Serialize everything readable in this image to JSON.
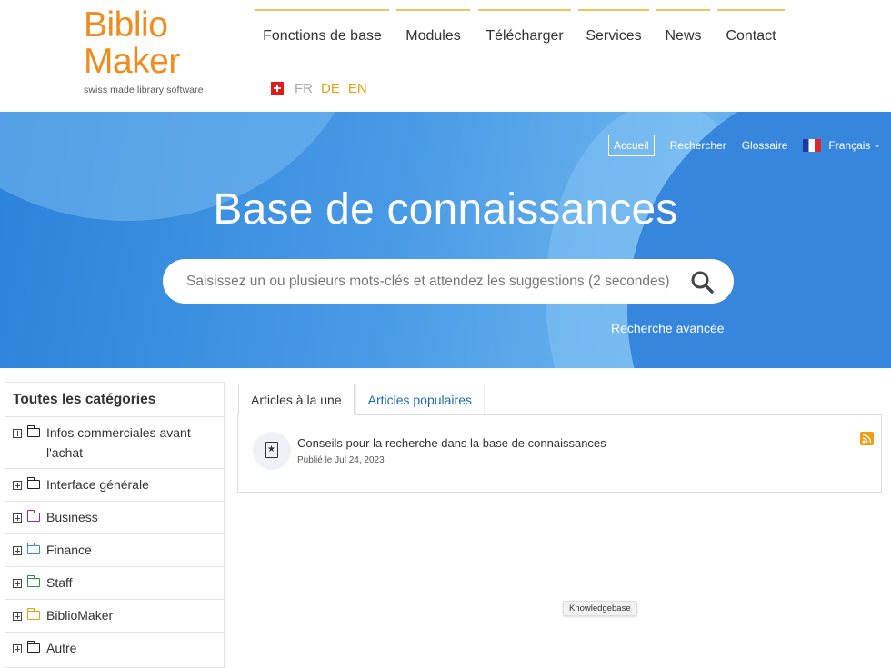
{
  "logo": {
    "line1": "Biblio",
    "line2": "Maker",
    "tagline": "swiss made library software"
  },
  "main_nav": [
    {
      "label": "Fonctions de base"
    },
    {
      "label": "Modules"
    },
    {
      "label": "Télécharger"
    },
    {
      "label": "Services"
    },
    {
      "label": "News"
    },
    {
      "label": "Contact"
    }
  ],
  "languages": {
    "fr": "FR",
    "de": "DE",
    "en": "EN",
    "current": "FR"
  },
  "hero": {
    "nav": {
      "home": "Accueil",
      "search": "Rechercher",
      "glossary": "Glossaire",
      "language": "Français"
    },
    "title": "Base de connaissances",
    "search_placeholder": "Saisissez un ou plusieurs mots-clés et attendez les suggestions (2 secondes)",
    "advanced_search": "Recherche avancée"
  },
  "categories": {
    "heading": "Toutes les catégories",
    "items": [
      {
        "label": "Infos commerciales avant l'achat",
        "folder_color": "#222222"
      },
      {
        "label": "Interface générale",
        "folder_color": "#222222"
      },
      {
        "label": "Business",
        "folder_color": "#9b27af"
      },
      {
        "label": "Finance",
        "folder_color": "#2d8ee6"
      },
      {
        "label": "Staff",
        "folder_color": "#1e9c3f"
      },
      {
        "label": "BiblioMaker",
        "folder_color": "#e7a20f"
      },
      {
        "label": "Autre",
        "folder_color": "#222222"
      }
    ]
  },
  "tabs": {
    "featured": "Articles à la une",
    "popular": "Articles populaires",
    "active": "featured"
  },
  "articles": [
    {
      "title": "Conseils pour la recherche dans la base de connaissances",
      "date": "Publié le Jul 24, 2023"
    }
  ],
  "tooltip": "Knowledgebase",
  "colors": {
    "brand_orange": "#f08c1b",
    "nav_accent": "#f5c15a",
    "hero_blue": "#2b82d9",
    "link_blue": "#1a6bb5",
    "rss": "#f39c12"
  }
}
